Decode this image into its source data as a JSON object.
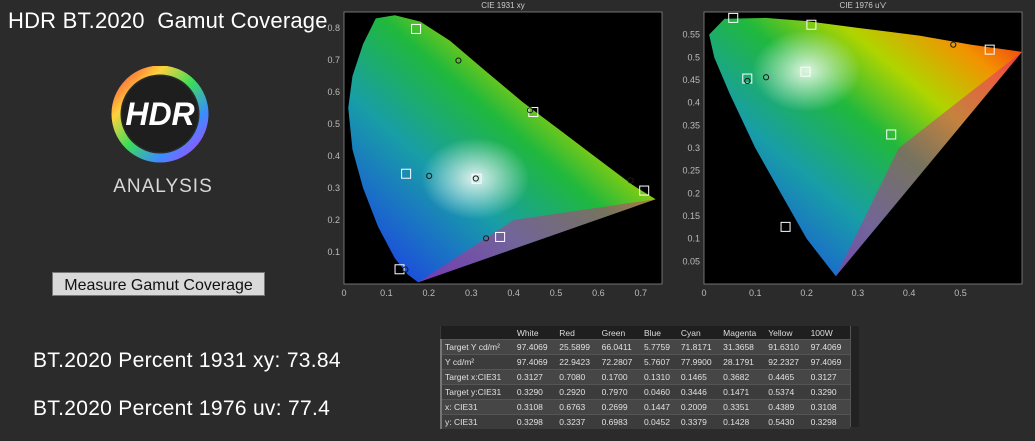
{
  "page": {
    "title": "HDR BT.2020  Gamut Coverage",
    "logo": {
      "text": "HDR",
      "subtitle": "ANALYSIS"
    },
    "measure_button": "Measure Gamut Coverage",
    "pct_1931_label": "BT.2020 Percent 1931 xy: 73.84",
    "pct_1976_label": "BT.2020 Percent 1976 uv: 77.4"
  },
  "chart_data": [
    {
      "type": "scatter",
      "title": "CIE 1931 xy",
      "xlim": [
        0,
        0.75
      ],
      "ylim": [
        0,
        0.85
      ],
      "xticks": [
        "0",
        "0.1",
        "0.2",
        "0.3",
        "0.4",
        "0.5",
        "0.6",
        "0.7"
      ],
      "yticks": [
        "0.1",
        "0.2",
        "0.3",
        "0.4",
        "0.5",
        "0.6",
        "0.7",
        "0.8"
      ],
      "background": "#000000",
      "series": [
        {
          "marker": "square",
          "points": [
            [
              0.708,
              0.292
            ],
            [
              0.17,
              0.797
            ],
            [
              0.131,
              0.046
            ],
            [
              0.1465,
              0.3446
            ],
            [
              0.3682,
              0.1471
            ],
            [
              0.4465,
              0.5374
            ],
            [
              0.3127,
              0.329
            ]
          ]
        },
        {
          "marker": "circle",
          "points": [
            [
              0.6763,
              0.3237
            ],
            [
              0.2699,
              0.6983
            ],
            [
              0.1447,
              0.0452
            ],
            [
              0.2009,
              0.3379
            ],
            [
              0.3351,
              0.1428
            ],
            [
              0.4389,
              0.543
            ],
            [
              0.3108,
              0.3298
            ]
          ]
        }
      ]
    },
    {
      "type": "scatter",
      "title": "CIE 1976 u'v'",
      "xlim": [
        0,
        0.62
      ],
      "ylim": [
        0,
        0.6
      ],
      "xticks": [
        "0",
        "0.1",
        "0.2",
        "0.3",
        "0.4",
        "0.5"
      ],
      "yticks": [
        "0.05",
        "0.1",
        "0.15",
        "0.2",
        "0.25",
        "0.3",
        "0.35",
        "0.4",
        "0.45",
        "0.5",
        "0.55"
      ],
      "background": "#000000",
      "series": [
        {
          "marker": "square",
          "points": [
            [
              0.557,
              0.517
            ],
            [
              0.057,
              0.587
            ],
            [
              0.159,
              0.126
            ],
            [
              0.0844,
              0.4532
            ],
            [
              0.365,
              0.3298
            ],
            [
              0.2094,
              0.5719
            ],
            [
              0.1978,
              0.4683
            ]
          ]
        },
        {
          "marker": "circle",
          "points": [
            [
              0.486,
              0.528
            ],
            [
              0.121,
              0.456
            ],
            [
              0.0846,
              0.4478
            ]
          ]
        }
      ]
    }
  ],
  "table": {
    "headers": [
      "",
      "White",
      "Red",
      "Green",
      "Blue",
      "Cyan",
      "Magenta",
      "Yellow",
      "100W"
    ],
    "rows": [
      [
        "Target Y cd/m²",
        "97.4069",
        "25.5899",
        "66.0411",
        "5.7759",
        "71.8171",
        "31.3658",
        "91.6310",
        "97.4069"
      ],
      [
        "Y cd/m²",
        "97.4069",
        "22.9423",
        "72.2807",
        "5.7607",
        "77.9900",
        "28.1791",
        "92.2327",
        "97.4069"
      ],
      [
        "Target x:CIE31",
        "0.3127",
        "0.7080",
        "0.1700",
        "0.1310",
        "0.1465",
        "0.3682",
        "0.4465",
        "0.3127"
      ],
      [
        "Target y:CIE31",
        "0.3290",
        "0.2920",
        "0.7970",
        "0.0460",
        "0.3446",
        "0.1471",
        "0.5374",
        "0.3290"
      ],
      [
        "x: CIE31",
        "0.3108",
        "0.6763",
        "0.2699",
        "0.1447",
        "0.2009",
        "0.3351",
        "0.4389",
        "0.3108"
      ],
      [
        "y: CIE31",
        "0.3298",
        "0.3237",
        "0.6983",
        "0.0452",
        "0.3379",
        "0.1428",
        "0.5430",
        "0.3298"
      ]
    ]
  },
  "colors": {
    "accent": "#ffffff",
    "plot_bg": "#000000",
    "panel": "#2b2b2b"
  }
}
